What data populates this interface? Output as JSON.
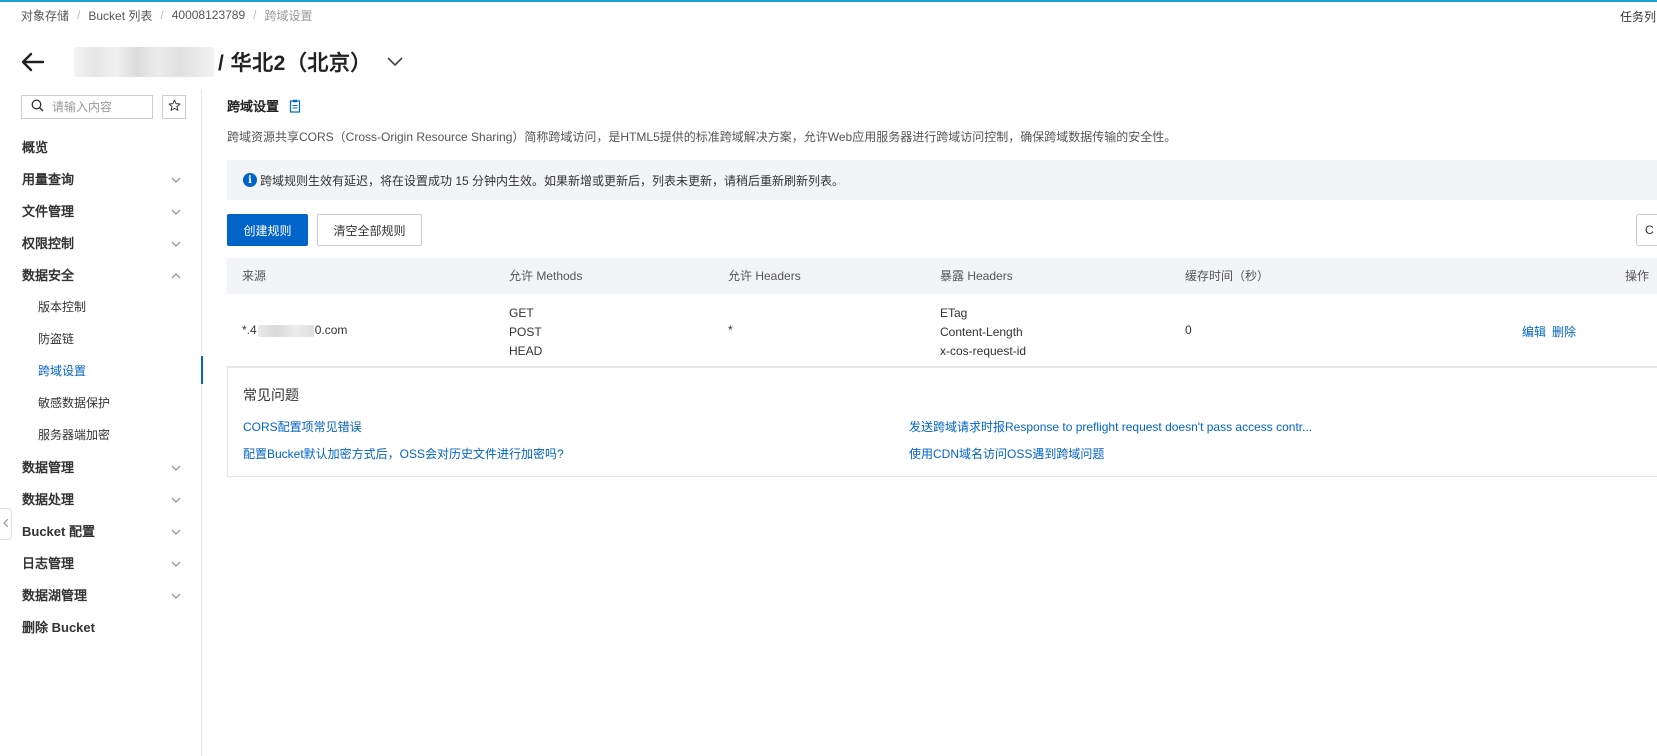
{
  "breadcrumb": {
    "items": [
      "对象存储",
      "Bucket 列表",
      "40008123789",
      "跨域设置"
    ]
  },
  "header": {
    "task_label": "任务列",
    "region_title": "/ 华北2（北京）"
  },
  "sidebar": {
    "search_placeholder": "请输入内容",
    "items": [
      {
        "label": "概览"
      },
      {
        "label": "用量查询"
      },
      {
        "label": "文件管理"
      },
      {
        "label": "权限控制"
      },
      {
        "label": "数据安全"
      },
      {
        "label": "版本控制"
      },
      {
        "label": "防盗链"
      },
      {
        "label": "跨域设置"
      },
      {
        "label": "敏感数据保护"
      },
      {
        "label": "服务器端加密"
      },
      {
        "label": "数据管理"
      },
      {
        "label": "数据处理"
      },
      {
        "label": "Bucket 配置"
      },
      {
        "label": "日志管理"
      },
      {
        "label": "数据湖管理"
      },
      {
        "label": "删除 Bucket"
      }
    ]
  },
  "main": {
    "title": "跨域设置",
    "description": "跨域资源共享CORS（Cross-Origin Resource Sharing）简称跨域访问，是HTML5提供的标准跨域解决方案，允许Web应用服务器进行跨域访问控制，确保跨域数据传输的安全性。",
    "notice": "跨域规则生效有延迟，将在设置成功 15 分钟内生效。如果新增或更新后，列表未更新，请稍后重新刷新列表。",
    "create_button": "创建规则",
    "clear_button": "清空全部规则",
    "edge_button": "C"
  },
  "table": {
    "headers": {
      "origin": "来源",
      "methods": "允许 Methods",
      "allow_headers": "允许 Headers",
      "expose_headers": "暴露 Headers",
      "cache": "缓存时间（秒）",
      "actions": "操作"
    },
    "rows": [
      {
        "origin_prefix": "*.4",
        "origin_suffix": "0.com",
        "methods": [
          "GET",
          "POST",
          "HEAD"
        ],
        "allow_headers": "*",
        "expose_headers": [
          "ETag",
          "Content-Length",
          "x-cos-request-id"
        ],
        "cache": "0",
        "edit_label": "编辑",
        "delete_label": "删除"
      }
    ]
  },
  "faq": {
    "title": "常见问题",
    "links": [
      "CORS配置项常见错误",
      "发送跨域请求时报Response to preflight request doesn't pass access contr...",
      "配置Bucket默认加密方式后，OSS会对历史文件进行加密吗?",
      "使用CDN域名访问OSS遇到跨域问题"
    ]
  },
  "colors": {
    "primary": "#0064c8",
    "notice_bg": "#f2f4f7",
    "top_accent": "#1aa0d8"
  }
}
